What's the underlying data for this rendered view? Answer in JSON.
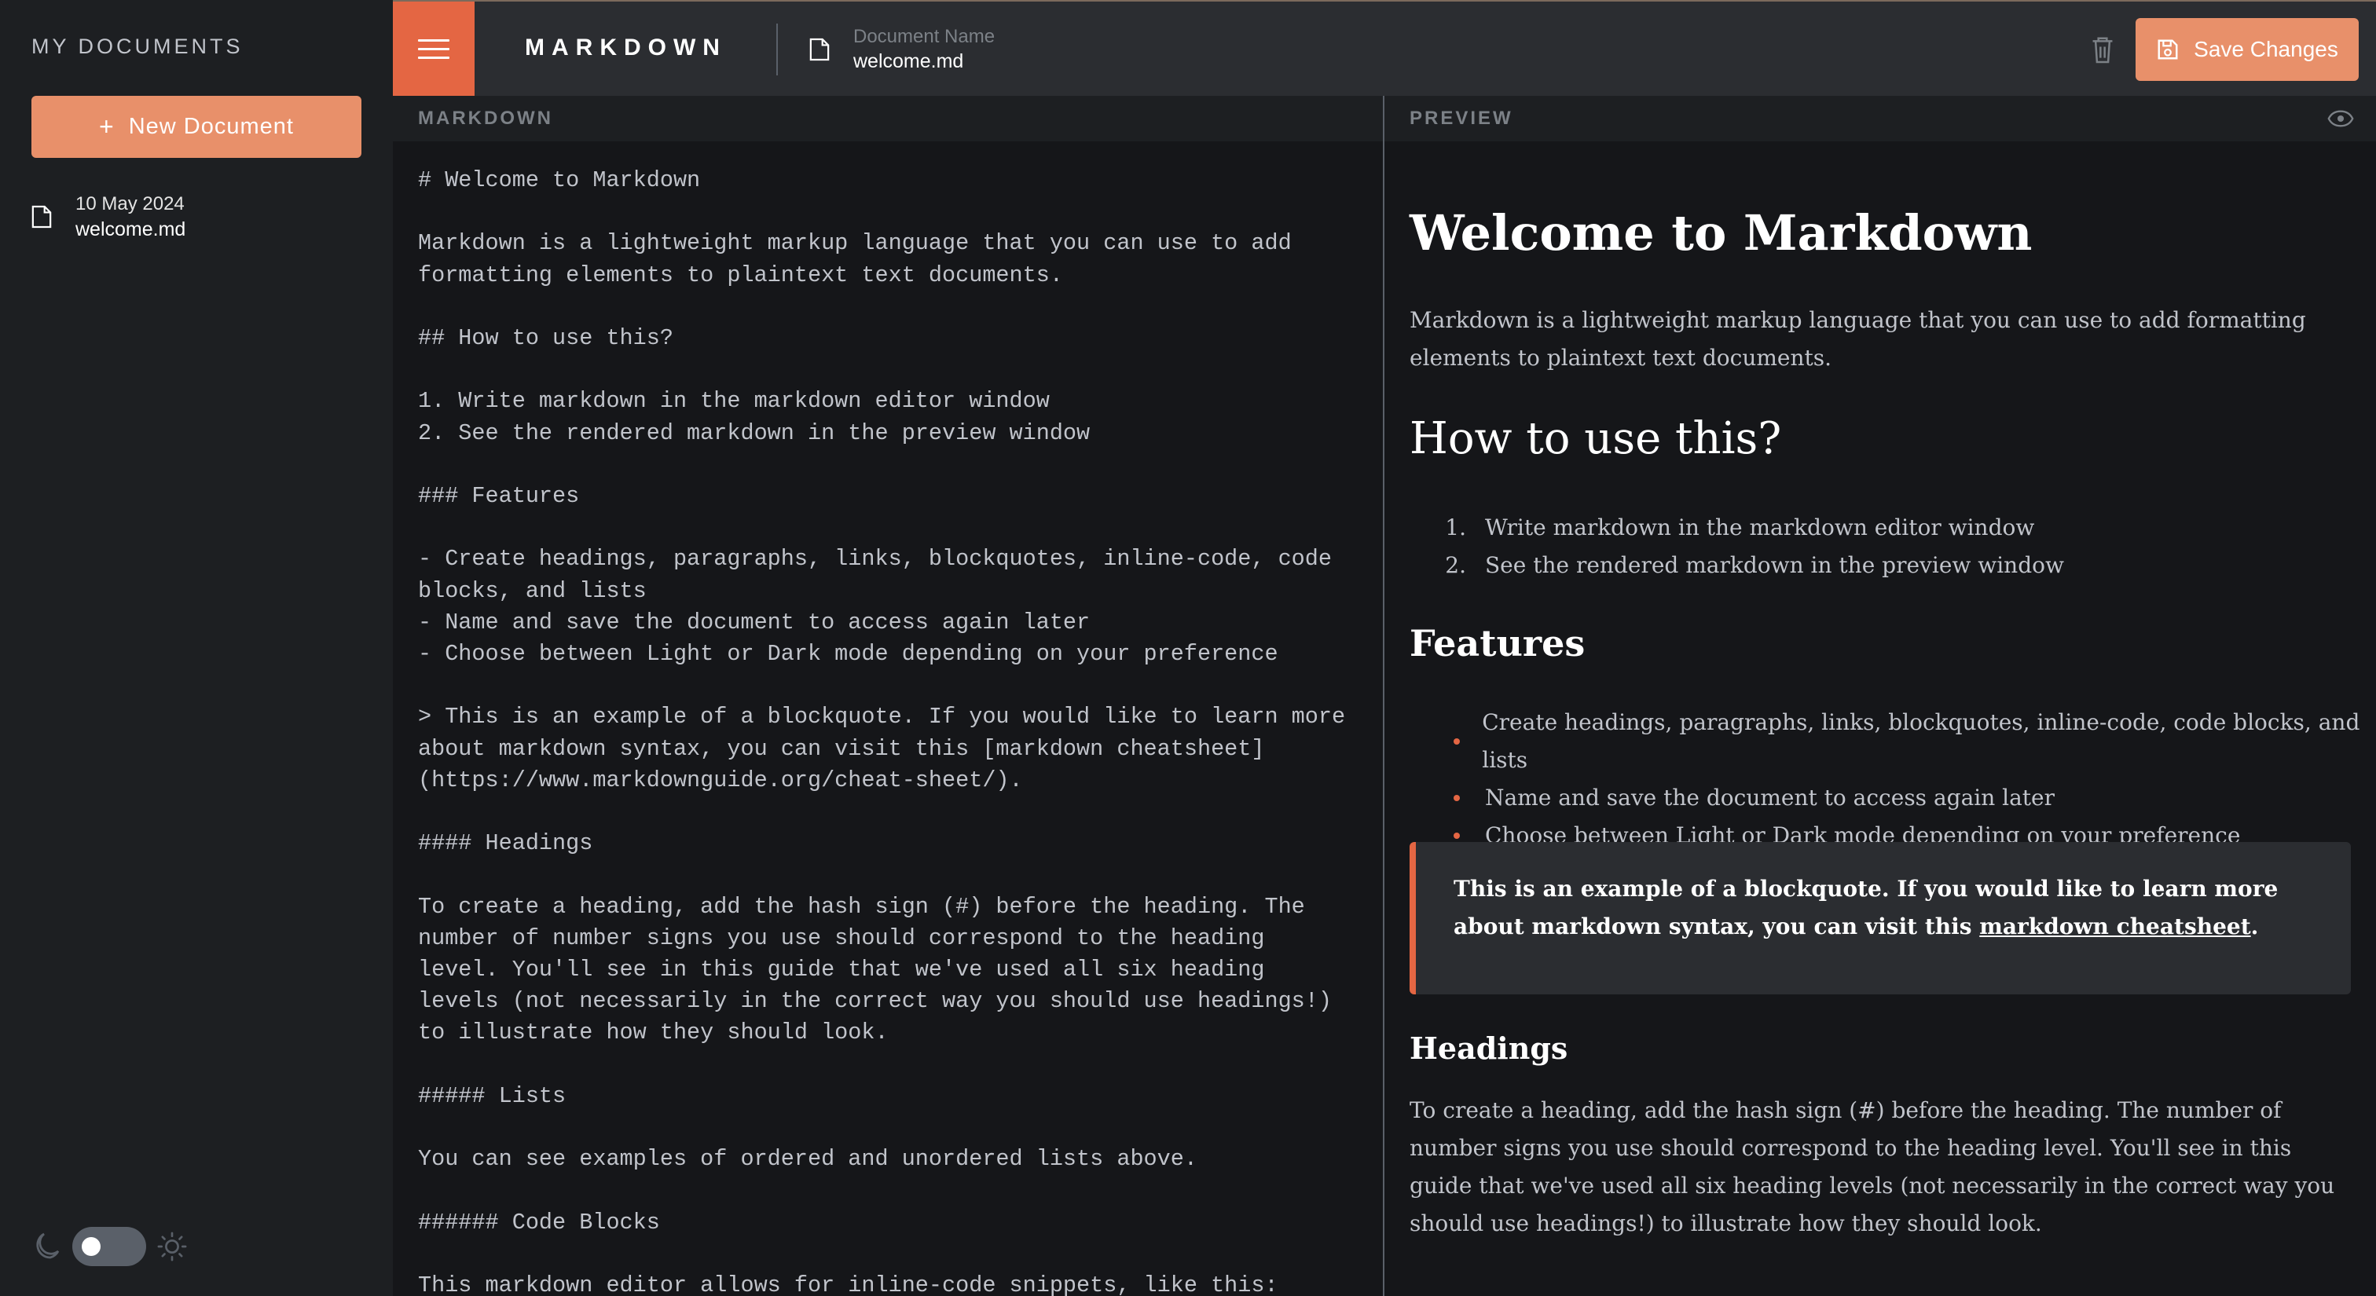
{
  "sidebar": {
    "title": "MY DOCUMENTS",
    "new_button": "+ New Document",
    "new_button_plus": "+",
    "new_button_label": "New Document",
    "documents": [
      {
        "date": "10 May 2024",
        "name": "welcome.md"
      }
    ]
  },
  "header": {
    "brand": "MARKDOWN",
    "doc_name_label": "Document Name",
    "doc_name_value": "welcome.md",
    "save_label": "Save Changes"
  },
  "panes": {
    "markdown_label": "MARKDOWN",
    "preview_label": "PREVIEW"
  },
  "editor": {
    "content": "# Welcome to Markdown\n\nMarkdown is a lightweight markup language that you can use to add formatting elements to plaintext text documents.\n\n## How to use this?\n\n1. Write markdown in the markdown editor window\n2. See the rendered markdown in the preview window\n\n### Features\n\n- Create headings, paragraphs, links, blockquotes, inline-code, code blocks, and lists\n- Name and save the document to access again later\n- Choose between Light or Dark mode depending on your preference\n\n> This is an example of a blockquote. If you would like to learn more about markdown syntax, you can visit this [markdown cheatsheet](https://www.markdownguide.org/cheat-sheet/).\n\n#### Headings\n\nTo create a heading, add the hash sign (#) before the heading. The number of number signs you use should correspond to the heading level. You'll see in this guide that we've used all six heading levels (not necessarily in the correct way you should use headings!) to illustrate how they should look.\n\n##### Lists\n\nYou can see examples of ordered and unordered lists above.\n\n###### Code Blocks\n\nThis markdown editor allows for inline-code snippets, like this:"
  },
  "preview": {
    "h1": "Welcome to Markdown",
    "p1": "Markdown is a lightweight markup language that you can use to add formatting elements to plaintext text documents.",
    "h2": "How to use this?",
    "ordered": [
      {
        "num": "1.",
        "text": "Write markdown in the markdown editor window"
      },
      {
        "num": "2.",
        "text": "See the rendered markdown in the preview window"
      }
    ],
    "h3": "Features",
    "unordered": [
      "Create headings, paragraphs, links, blockquotes, inline-code, code blocks, and lists",
      "Name and save the document to access again later",
      "Choose between Light or Dark mode depending on your preference"
    ],
    "blockquote_text": "This is an example of a blockquote. If you would like to learn more about markdown syntax, you can visit this ",
    "blockquote_link": "markdown cheatsheet",
    "blockquote_end": ".",
    "h4": "Headings",
    "p2": "To create a heading, add the hash sign (#) before the heading. The number of number signs you use should correspond to the heading level. You'll see in this guide that we've used all six heading levels (not necessarily in the correct way you should use headings!) to illustrate how they should look."
  },
  "theme": {
    "mode": "dark",
    "icons": [
      "moon-icon",
      "sun-icon"
    ]
  },
  "colors": {
    "accent": "#e46643",
    "accent_hover": "#e8906a",
    "sidebar_bg": "#1d1f22",
    "header_bg": "#2b2d31",
    "page_bg": "#151619"
  }
}
